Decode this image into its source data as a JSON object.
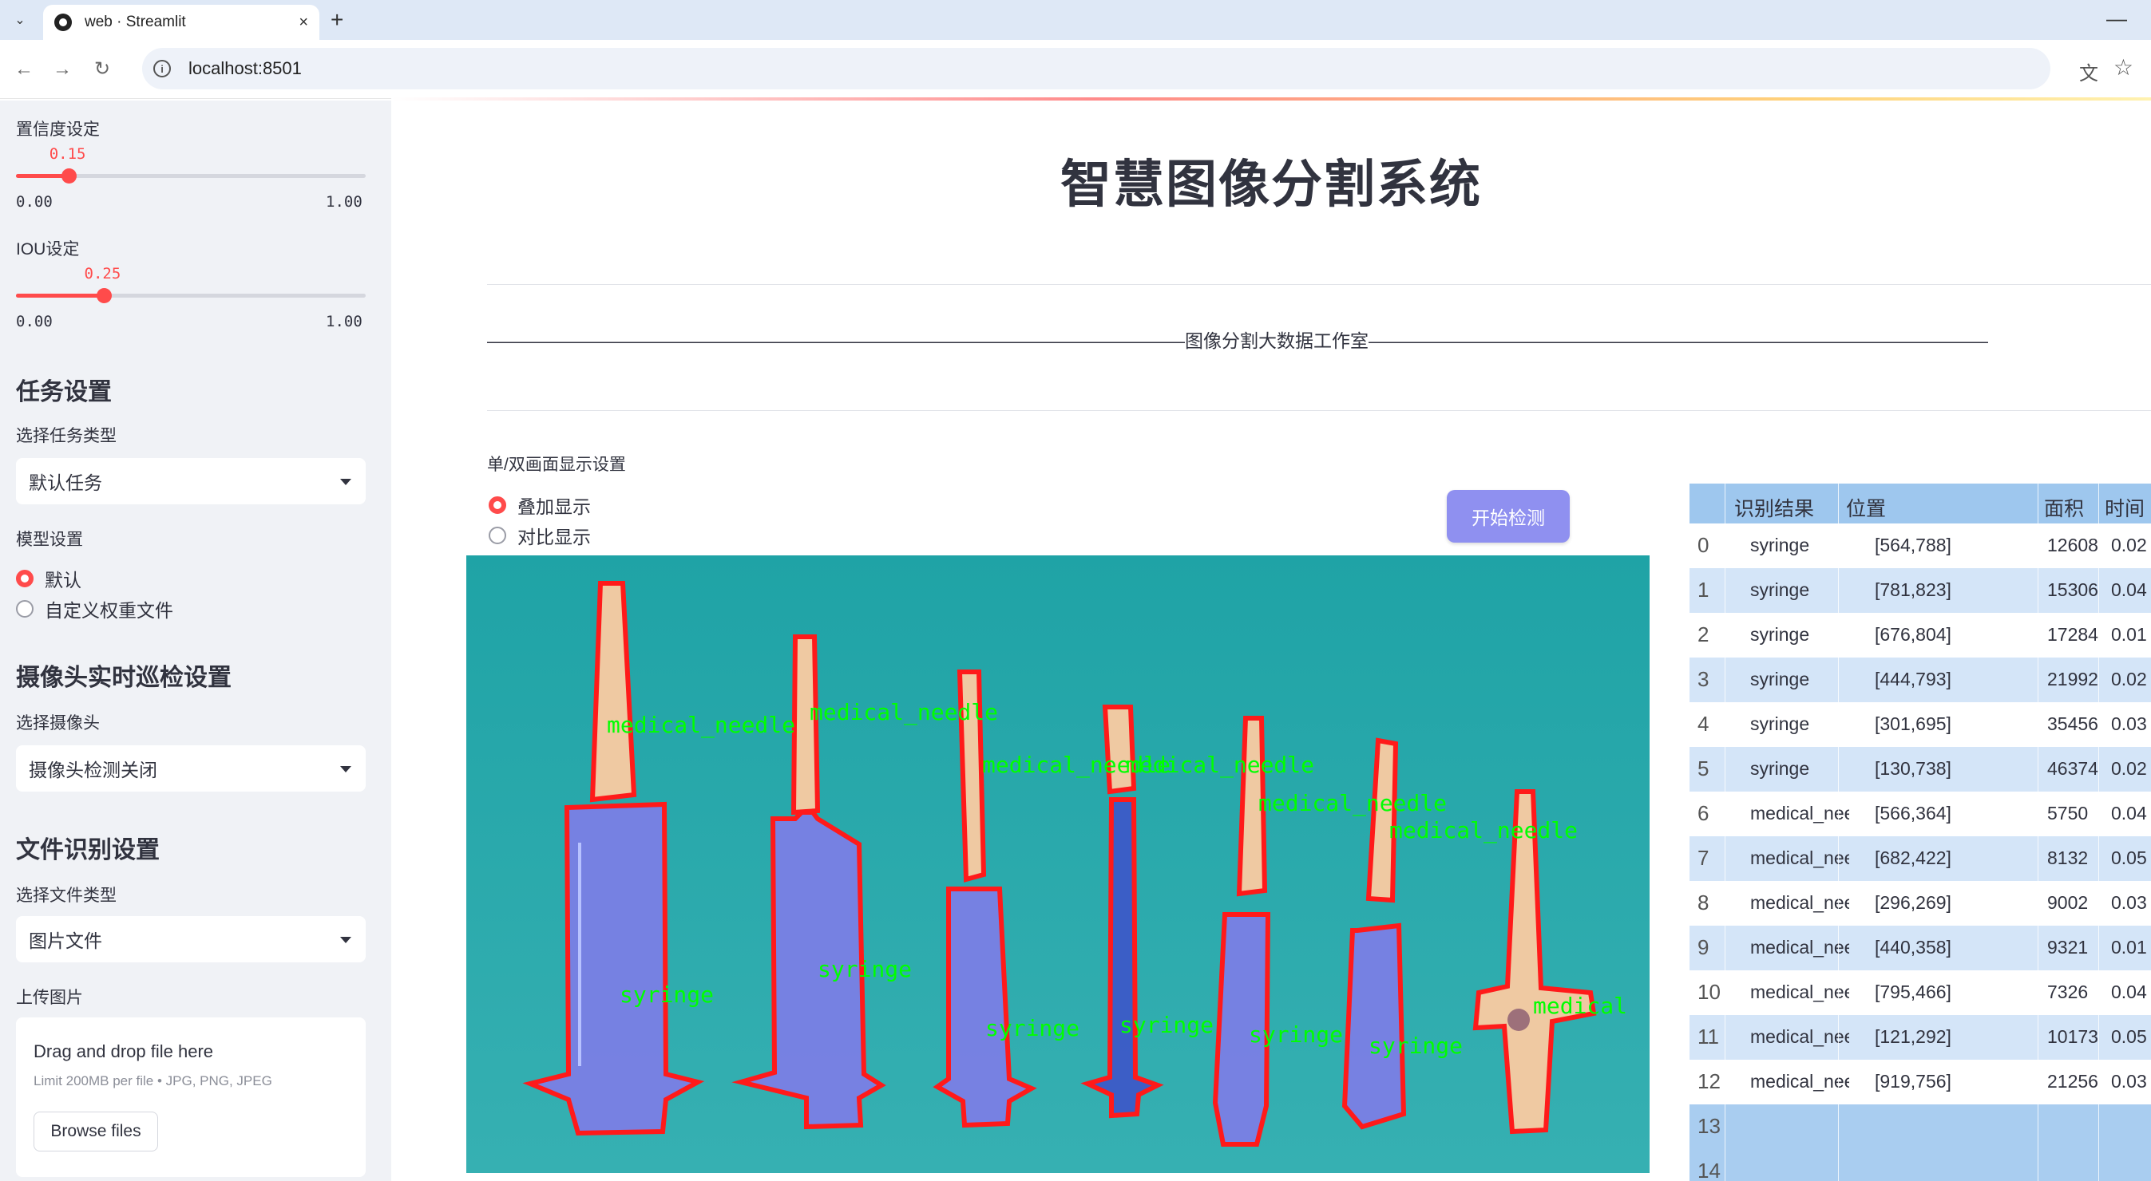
{
  "browser": {
    "tab_title": "web · Streamlit",
    "url": "localhost:8501",
    "new_tab": "+",
    "close": "×"
  },
  "sidebar": {
    "confidence": {
      "label": "置信度设定",
      "value": 0.15,
      "value_text": "0.15",
      "min": "0.00",
      "max": "1.00"
    },
    "iou": {
      "label": "IOU设定",
      "value": 0.25,
      "value_text": "0.25",
      "min": "0.00",
      "max": "1.00"
    },
    "task_heading": "任务设置",
    "task_type_label": "选择任务类型",
    "task_type_value": "默认任务",
    "model_label": "模型设置",
    "model_options": [
      "默认",
      "自定义权重文件"
    ],
    "model_selected": "默认",
    "camera_heading": "摄像头实时巡检设置",
    "camera_label": "选择摄像头",
    "camera_value": "摄像头检测关闭",
    "file_heading": "文件识别设置",
    "file_type_label": "选择文件类型",
    "file_type_value": "图片文件",
    "upload_label": "上传图片",
    "upload": {
      "title": "Drag and drop file here",
      "limit": "Limit 200MB per file • JPG, PNG, JPEG",
      "button": "Browse files"
    }
  },
  "main": {
    "title": "智慧图像分割系统",
    "subtitle_line": "——————————————————————————————————————图像分割大数据工作室——————————————————————————————————————",
    "display_label": "单/双画面显示设置",
    "display_options": [
      "叠加显示",
      "对比显示"
    ],
    "display_selected": "叠加显示",
    "detect_button": "开始检测",
    "overlay_labels": {
      "needle": "medical_needle",
      "syringe": "syringe",
      "needle_cut": "medical"
    }
  },
  "table": {
    "headers": [
      "识别结果",
      "位置",
      "面积",
      "时间"
    ],
    "rows": [
      {
        "idx": "0",
        "name": "syringe",
        "pos": "[564,788]",
        "area": "12608",
        "time": "0.02"
      },
      {
        "idx": "1",
        "name": "syringe",
        "pos": "[781,823]",
        "area": "15306",
        "time": "0.04"
      },
      {
        "idx": "2",
        "name": "syringe",
        "pos": "[676,804]",
        "area": "17284",
        "time": "0.01"
      },
      {
        "idx": "3",
        "name": "syringe",
        "pos": "[444,793]",
        "area": "21992",
        "time": "0.02"
      },
      {
        "idx": "4",
        "name": "syringe",
        "pos": "[301,695]",
        "area": "35456",
        "time": "0.03"
      },
      {
        "idx": "5",
        "name": "syringe",
        "pos": "[130,738]",
        "area": "46374",
        "time": "0.02"
      },
      {
        "idx": "6",
        "name": "medical_needle",
        "pos": "[566,364]",
        "area": "5750",
        "time": "0.04"
      },
      {
        "idx": "7",
        "name": "medical_needle",
        "pos": "[682,422]",
        "area": "8132",
        "time": "0.05"
      },
      {
        "idx": "8",
        "name": "medical_needle",
        "pos": "[296,269]",
        "area": "9002",
        "time": "0.03"
      },
      {
        "idx": "9",
        "name": "medical_needle",
        "pos": "[440,358]",
        "area": "9321",
        "time": "0.01"
      },
      {
        "idx": "10",
        "name": "medical_needle",
        "pos": "[795,466]",
        "area": "7326",
        "time": "0.04"
      },
      {
        "idx": "11",
        "name": "medical_needle",
        "pos": "[121,292]",
        "area": "10173",
        "time": "0.05"
      },
      {
        "idx": "12",
        "name": "medical_needle",
        "pos": "[919,756]",
        "area": "21256",
        "time": "0.03"
      },
      {
        "idx": "13",
        "name": "",
        "pos": "",
        "area": "",
        "time": ""
      },
      {
        "idx": "14",
        "name": "",
        "pos": "",
        "area": "",
        "time": ""
      }
    ]
  },
  "colors": {
    "accent": "#ff4b4b",
    "sidebar_bg": "#f0f2f6",
    "button": "#8f90f0",
    "table_header": "#9ec7ee",
    "image_bg": "#2aa7ab",
    "mask_outline": "#ff1a1a",
    "label_green": "#00ff00"
  }
}
